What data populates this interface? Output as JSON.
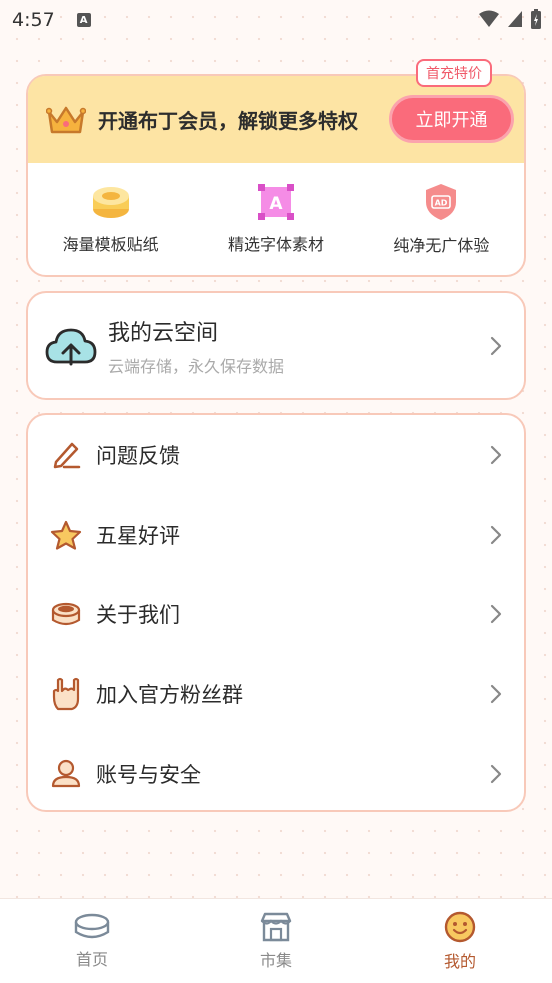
{
  "status_bar": {
    "time": "4:57",
    "notification_letter": "A"
  },
  "vip": {
    "title": "开通布丁会员，解锁更多特权",
    "button_label": "立即开通",
    "badge": "首充特价",
    "features": [
      {
        "label": "海量模板贴纸",
        "icon": "pudding-icon"
      },
      {
        "label": "精选字体素材",
        "icon": "font-icon"
      },
      {
        "label": "纯净无广体验",
        "icon": "no-ad-shield-icon"
      }
    ]
  },
  "cloud": {
    "title": "我的云空间",
    "subtitle": "云端存储，永久保存数据",
    "icon": "cloud-upload-icon"
  },
  "menu": {
    "items": [
      {
        "label": "问题反馈",
        "icon": "pencil-icon"
      },
      {
        "label": "五星好评",
        "icon": "star-icon"
      },
      {
        "label": "关于我们",
        "icon": "pudding-icon"
      },
      {
        "label": "加入官方粉丝群",
        "icon": "rock-hand-icon"
      },
      {
        "label": "账号与安全",
        "icon": "user-icon"
      }
    ]
  },
  "tabbar": {
    "tabs": [
      {
        "label": "首页",
        "icon": "pudding-icon",
        "active": false
      },
      {
        "label": "市集",
        "icon": "shop-icon",
        "active": false
      },
      {
        "label": "我的",
        "icon": "smiley-icon",
        "active": true
      }
    ]
  },
  "colors": {
    "accent": "#fa6b7b",
    "card_border": "#f8c9b9",
    "vip_bg": "#fde4a4",
    "active_tab": "#b4592f"
  }
}
